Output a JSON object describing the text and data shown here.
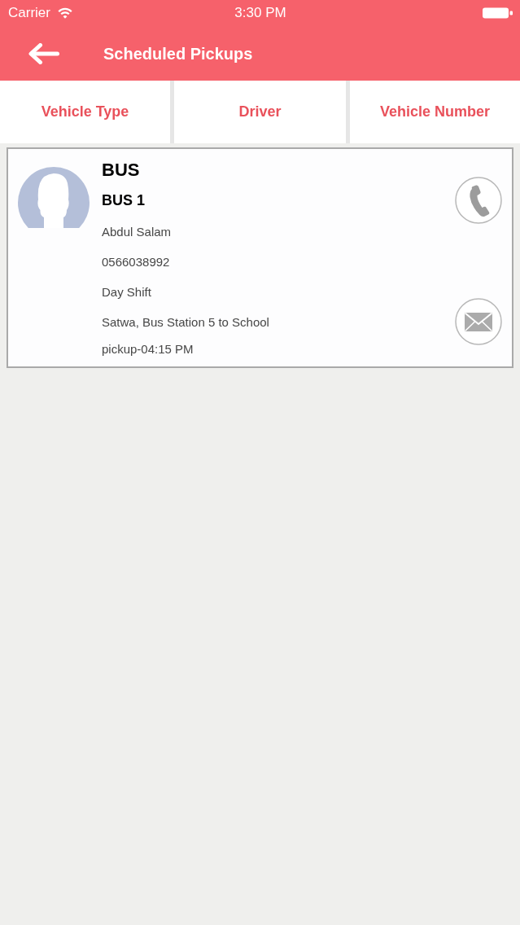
{
  "status_bar": {
    "carrier": "Carrier",
    "time": "3:30 PM"
  },
  "nav_bar": {
    "title": "Scheduled Pickups"
  },
  "tabs": [
    {
      "label": "Vehicle Type"
    },
    {
      "label": "Driver"
    },
    {
      "label": "Vehicle Number"
    }
  ],
  "pickups": [
    {
      "vehicle_type": "BUS",
      "vehicle_number": "BUS 1",
      "driver": "Abdul Salam",
      "phone": "0566038992",
      "shift": "Day Shift",
      "route": "Satwa, Bus Station 5 to School",
      "pickup_time": "pickup-04:15 PM"
    }
  ]
}
